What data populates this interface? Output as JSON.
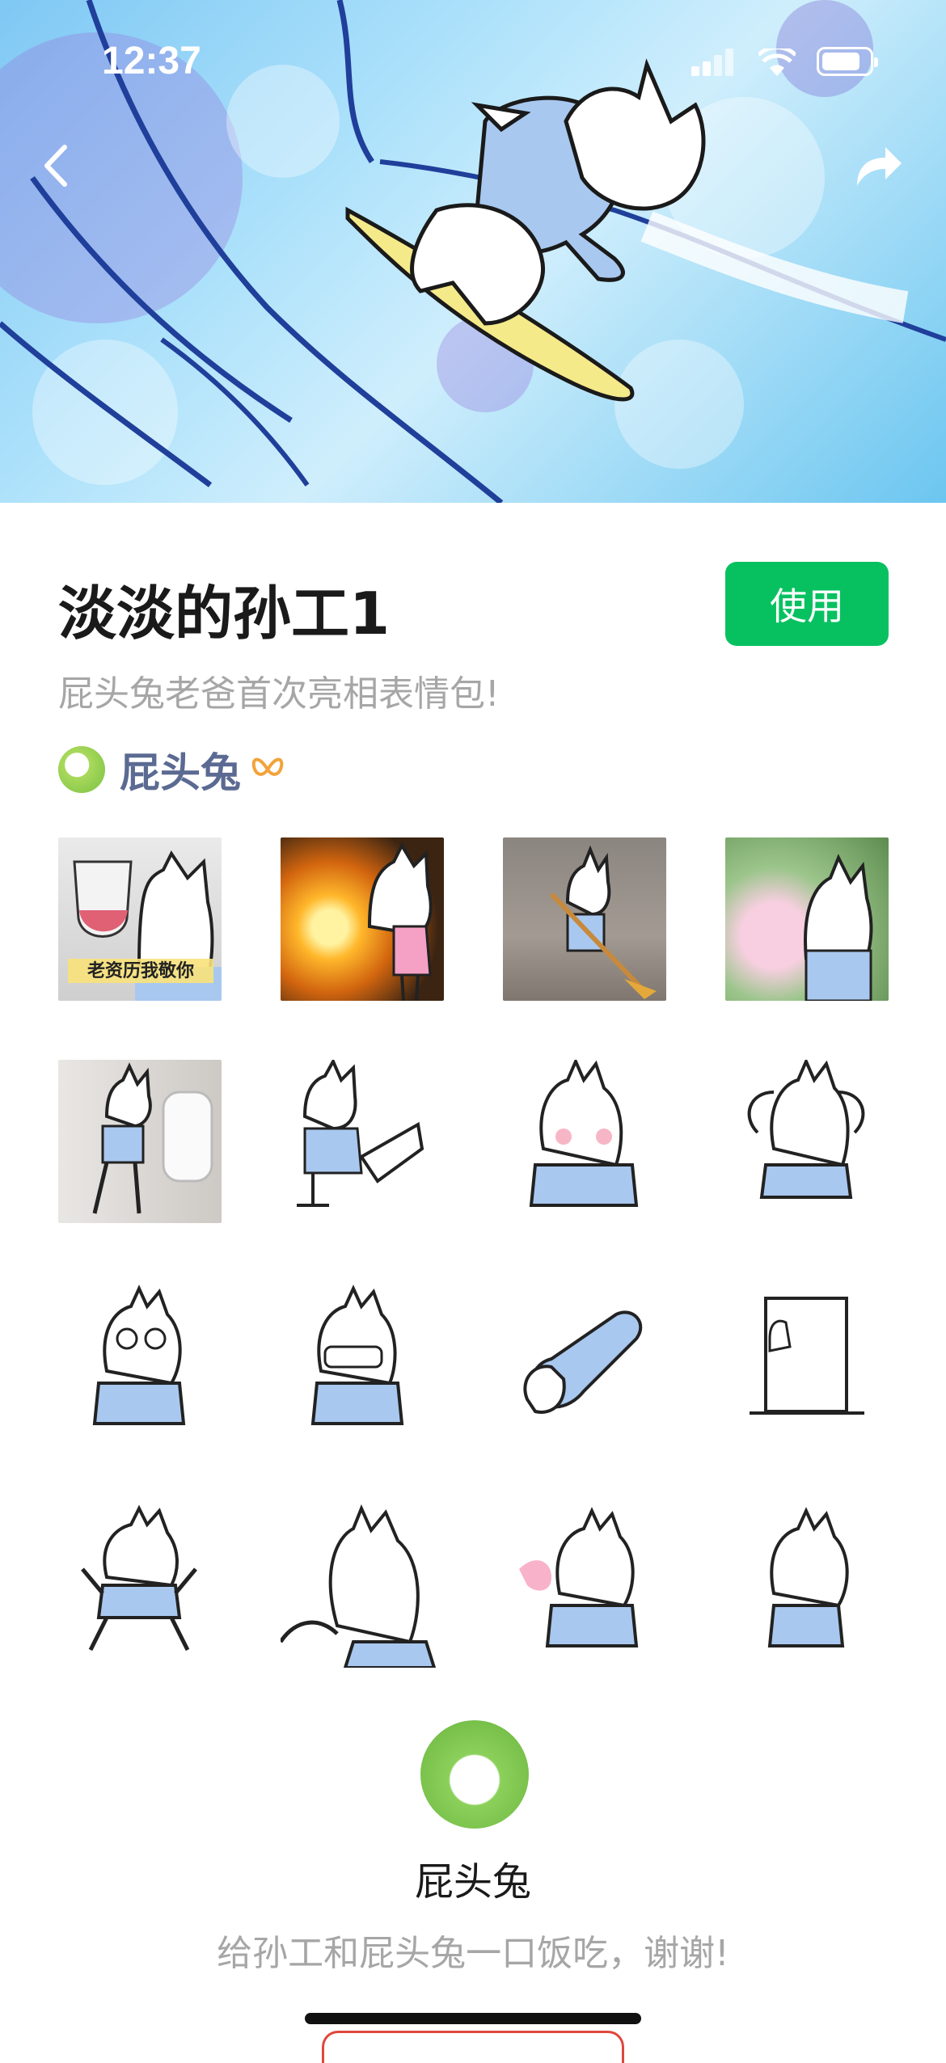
{
  "status_bar": {
    "time": "12:37"
  },
  "nav": {
    "back_icon": "chevron-left-icon",
    "share_icon": "share-arrow-icon"
  },
  "pack": {
    "title": "淡淡的孙工1",
    "use_label": "使用",
    "subtitle": "屁头兔老爸首次亮相表情包!",
    "author": "屁头兔"
  },
  "stickers": [
    {
      "caption": "老资历我敬你"
    },
    {
      "caption": ""
    },
    {
      "caption": ""
    },
    {
      "caption": ""
    },
    {
      "caption": ""
    },
    {
      "caption": ""
    },
    {
      "caption": ""
    },
    {
      "caption": ""
    },
    {
      "caption": ""
    },
    {
      "caption": ""
    },
    {
      "caption": ""
    },
    {
      "caption": ""
    },
    {
      "caption": ""
    },
    {
      "caption": ""
    },
    {
      "caption": ""
    },
    {
      "caption": ""
    }
  ],
  "footer": {
    "author_name": "屁头兔",
    "thanks": "给孙工和屁头兔一口饭吃，谢谢!"
  },
  "colors": {
    "accent_green": "#07c160",
    "author_blue": "#5b6a92",
    "sticker_shirt": "#a9c8ef"
  }
}
